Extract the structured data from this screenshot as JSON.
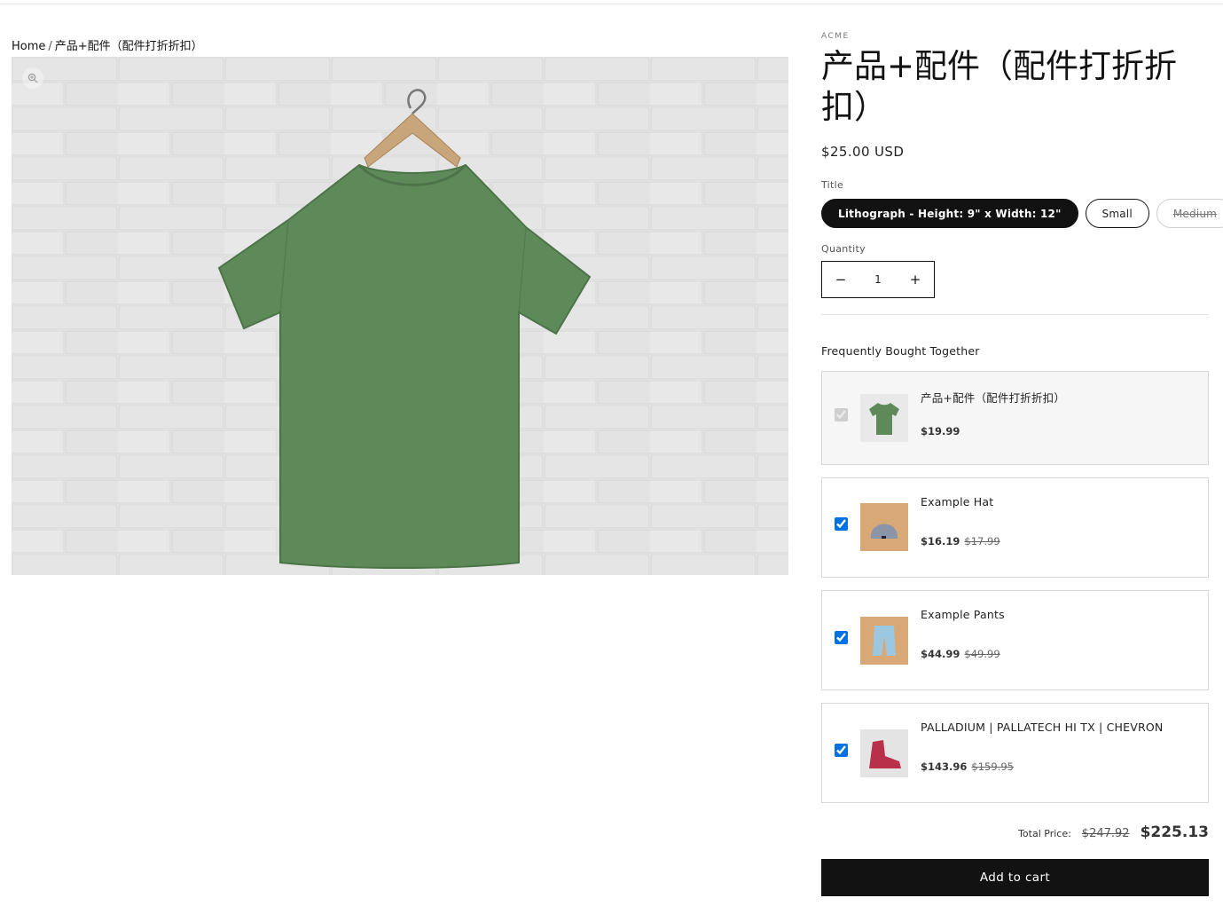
{
  "breadcrumb": {
    "home": "Home",
    "separator": "/",
    "current": "产品+配件（配件打折折扣）"
  },
  "product": {
    "vendor": "ACME",
    "title": "产品+配件（配件打折折扣）",
    "price": "$25.00 USD",
    "option_label": "Title",
    "options": [
      "Lithograph - Height: 9\" x Width: 12\"",
      "Small",
      "Medium"
    ],
    "selected_option": "Lithograph - Height: 9\" x Width: 12\"",
    "quantity_label": "Quantity",
    "quantity": "1",
    "decrease_icon": "minus-icon",
    "increase_icon": "plus-icon"
  },
  "hero": {
    "zoom_icon": "zoom-in-icon",
    "image_subject": "green t-shirt",
    "tshirt_color": "#5e8a5a"
  },
  "fbt": {
    "title": "Frequently Bought Together",
    "items": [
      {
        "name": "产品+配件（配件打折折扣）",
        "price": "$19.99",
        "compare": "",
        "checked": true,
        "disabled": true,
        "thumb_color": "#5e8a5a"
      },
      {
        "name": "Example Hat",
        "price": "$16.19",
        "compare": "$17.99",
        "checked": true,
        "disabled": false,
        "thumb_color": "#8a96a8"
      },
      {
        "name": "Example Pants",
        "price": "$44.99",
        "compare": "$49.99",
        "checked": true,
        "disabled": false,
        "thumb_color": "#9cc7e0"
      },
      {
        "name": "PALLADIUM | PALLATECH HI TX | CHEVRON",
        "price": "$143.96",
        "compare": "$159.95",
        "checked": true,
        "disabled": false,
        "thumb_color": "#b8304a"
      }
    ]
  },
  "total": {
    "label": "Total Price:",
    "compare": "$247.92",
    "price": "$225.13"
  },
  "cart": {
    "add_label": "Add to cart"
  },
  "colors": {
    "accent": "#121212",
    "checkbox": "#0071e3"
  }
}
